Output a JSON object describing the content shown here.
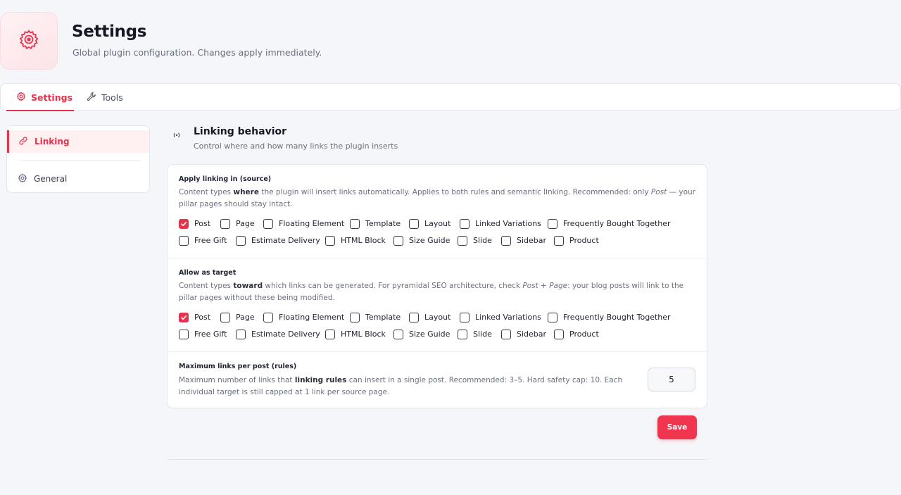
{
  "header": {
    "title": "Settings",
    "subtitle": "Global plugin configuration. Changes apply immediately.",
    "icon": "gear-icon"
  },
  "tabs": [
    {
      "label": "Settings",
      "icon": "gear-icon",
      "active": true
    },
    {
      "label": "Tools",
      "icon": "wrench-icon",
      "active": false
    }
  ],
  "sidebar": {
    "items": [
      {
        "label": "Linking",
        "icon": "link-icon",
        "active": true
      },
      {
        "label": "General",
        "icon": "gear-icon",
        "active": false
      }
    ]
  },
  "section": {
    "title": "Linking behavior",
    "description": "Control where and how many links the plugin inserts",
    "icon": "broadcast-icon"
  },
  "source": {
    "label": "Apply linking in (source)",
    "help_1": "Content types ",
    "help_bold": "where",
    "help_2": " the plugin will insert links automatically. Applies to both rules and semantic linking. Recommended: only ",
    "help_italic": "Post",
    "help_3": " — your pillar pages should stay intact.",
    "options": [
      {
        "label": "Post",
        "checked": true
      },
      {
        "label": "Page",
        "checked": false
      },
      {
        "label": "Floating Element",
        "checked": false
      },
      {
        "label": "Template",
        "checked": false
      },
      {
        "label": "Layout",
        "checked": false
      },
      {
        "label": "Linked Variations",
        "checked": false
      },
      {
        "label": "Frequently Bought Together",
        "checked": false
      },
      {
        "label": "Free Gift",
        "checked": false
      },
      {
        "label": "Estimate Delivery",
        "checked": false
      },
      {
        "label": "HTML Block",
        "checked": false
      },
      {
        "label": "Size Guide",
        "checked": false
      },
      {
        "label": "Slide",
        "checked": false
      },
      {
        "label": "Sidebar",
        "checked": false
      },
      {
        "label": "Product",
        "checked": false
      }
    ]
  },
  "target": {
    "label": "Allow as target",
    "help_1": "Content types ",
    "help_bold": "toward",
    "help_2": " which links can be generated. For pyramidal SEO architecture, check ",
    "help_italic": "Post + Page",
    "help_3": ": your blog posts will link to the pillar pages without these being modified.",
    "options": [
      {
        "label": "Post",
        "checked": true
      },
      {
        "label": "Page",
        "checked": false
      },
      {
        "label": "Floating Element",
        "checked": false
      },
      {
        "label": "Template",
        "checked": false
      },
      {
        "label": "Layout",
        "checked": false
      },
      {
        "label": "Linked Variations",
        "checked": false
      },
      {
        "label": "Frequently Bought Together",
        "checked": false
      },
      {
        "label": "Free Gift",
        "checked": false
      },
      {
        "label": "Estimate Delivery",
        "checked": false
      },
      {
        "label": "HTML Block",
        "checked": false
      },
      {
        "label": "Size Guide",
        "checked": false
      },
      {
        "label": "Slide",
        "checked": false
      },
      {
        "label": "Sidebar",
        "checked": false
      },
      {
        "label": "Product",
        "checked": false
      }
    ]
  },
  "max_links": {
    "label": "Maximum links per post (rules)",
    "help_1": "Maximum number of links that ",
    "help_bold": "linking rules",
    "help_2": " can insert in a single post. Recommended: 3–5. Hard safety cap: 10. Each individual target is still capped at 1 link per source page.",
    "value": "5"
  },
  "save_label": "Save",
  "colors": {
    "accent": "#e8334d",
    "background": "#f5f6f9"
  }
}
